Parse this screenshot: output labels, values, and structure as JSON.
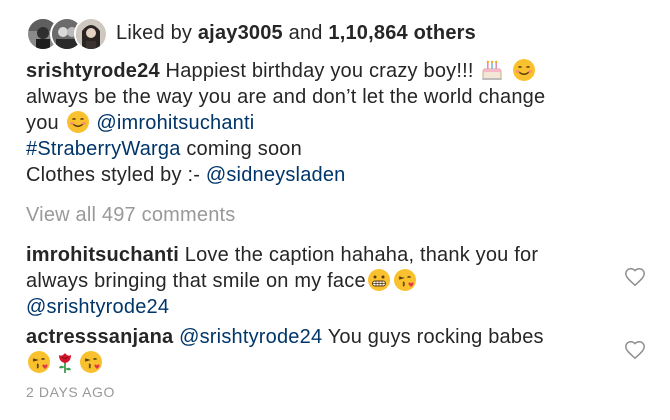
{
  "likes": {
    "prefix": "Liked by",
    "first_user": "ajay3005",
    "and": "and",
    "count": "1,10,864",
    "others": "others"
  },
  "caption": {
    "username": "srishtyrode24",
    "text1": "Happiest birthday you crazy boy!!!",
    "text2": "always be the way you are and don’t let the world change",
    "text3": "you",
    "mention1": "@imrohitsuchanti",
    "hashtag": "#StraberryWarga",
    "hashtag_suffix": "coming soon",
    "styled_by": "Clothes styled by :-",
    "mention2": "@sidneysladen"
  },
  "view_all_comments": "View all 497 comments",
  "comments": [
    {
      "username": "imrohitsuchanti",
      "text1": "Love the caption hahaha, thank you for",
      "text2": "always bringing that smile on my face",
      "mention": "@srishtyrode24"
    },
    {
      "username": "actresssanjana",
      "mention": "@srishtyrode24",
      "text": "You guys rocking babes"
    }
  ],
  "timestamp": "2 DAYS AGO",
  "icons": {
    "like": "heart-outline-icon",
    "cake": "birthday-cake-emoji",
    "blush": "smiling-face-emoji",
    "grimace": "grimacing-face-emoji",
    "kiss": "face-blowing-kiss-emoji",
    "rose": "rose-emoji"
  },
  "colors": {
    "text": "#262626",
    "link": "#003569",
    "muted": "#999999"
  }
}
